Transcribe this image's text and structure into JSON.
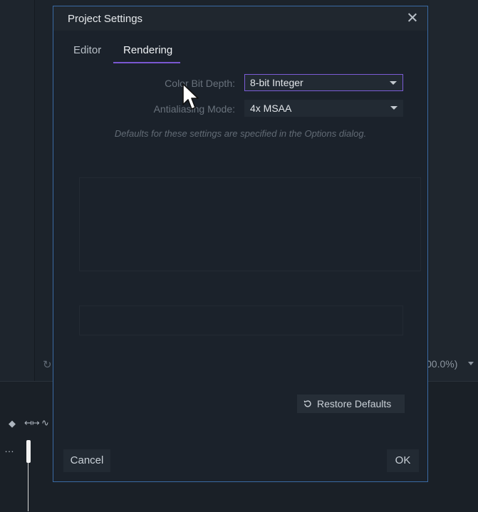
{
  "background": {
    "zoom_readout": "00.0%)"
  },
  "dialog": {
    "title": "Project Settings",
    "tabs": [
      {
        "label": "Editor",
        "active": false
      },
      {
        "label": "Rendering",
        "active": true
      }
    ],
    "fields": {
      "color_bit_depth": {
        "label": "Color Bit Depth:",
        "value": "8-bit Integer"
      },
      "antialiasing_mode": {
        "label": "Antialiasing Mode:",
        "value": "4x MSAA"
      }
    },
    "note": "Defaults for these settings are specified in the Options dialog.",
    "restore_defaults_label": "Restore Defaults",
    "cancel_label": "Cancel",
    "ok_label": "OK"
  },
  "colors": {
    "accent": "#7b5cd6",
    "dialog_border": "#3a6aa3",
    "background": "#1c232b"
  },
  "icons": [
    "close-icon",
    "chevron-down-icon",
    "refresh-icon",
    "mouse-pointer-icon",
    "diamond-icon",
    "fit-width-icon",
    "curve-icon",
    "more-icon"
  ]
}
